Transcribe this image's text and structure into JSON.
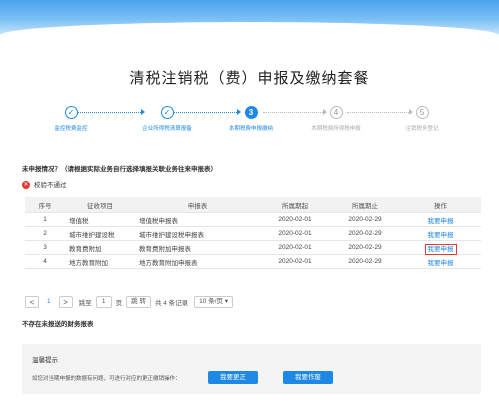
{
  "page": {
    "title": "清税注销税（费）申报及缴纳套餐"
  },
  "steps": [
    {
      "num": "",
      "label": "监控税费监控",
      "state": "done"
    },
    {
      "num": "",
      "label": "企业所得税清算报备",
      "state": "done"
    },
    {
      "num": "3",
      "label": "本期税费申报缴纳",
      "state": "cur"
    },
    {
      "num": "4",
      "label": "本期税费所得税申报",
      "state": "todo"
    },
    {
      "num": "5",
      "label": "注销税务登记",
      "state": "todo"
    }
  ],
  "notice": {
    "question_bold": "未申报情况？",
    "question_rest": "（请根据实际业务自行选择填报关联业务往来申报表）",
    "fail_text": "校验不通过"
  },
  "table": {
    "headers": [
      "序号",
      "征收项目",
      "申报表",
      "所属期起",
      "所属期止",
      "操作"
    ],
    "rows": [
      {
        "no": "1",
        "item": "增值税",
        "form": "增值税申报表",
        "start": "2020-02-01",
        "end": "2020-02-29",
        "op": "我要申报"
      },
      {
        "no": "2",
        "item": "城市维护建设税",
        "form": "城市维护建设税申报表",
        "start": "2020-02-01",
        "end": "2020-02-29",
        "op": "我要申报"
      },
      {
        "no": "3",
        "item": "教育费附加",
        "form": "教育费附加申报表",
        "start": "2020-02-01",
        "end": "2020-02-29",
        "op": "我要申报"
      },
      {
        "no": "4",
        "item": "地方教育附加",
        "form": "地方教育附加申报表",
        "start": "2020-02-01",
        "end": "2020-02-29",
        "op": "我要申报"
      }
    ]
  },
  "pager": {
    "prev": "<",
    "page": "1",
    "next": ">",
    "goto_label": "跳至",
    "goto_value": "1",
    "page_unit": "页",
    "go_btn": "跳 转",
    "total": "共 4 条记录",
    "page_size": "10 条/页 ▾"
  },
  "no_report": "不存在未报送的财务报表",
  "tip": {
    "title": "温馨提示",
    "text": "如您对当期申报的数据有问题，可进行对应的更正缴销操作：",
    "btn_correct": "我要更正",
    "btn_void": "我要作废"
  },
  "colors": {
    "accent": "#1e88e5",
    "error": "#e53935"
  }
}
